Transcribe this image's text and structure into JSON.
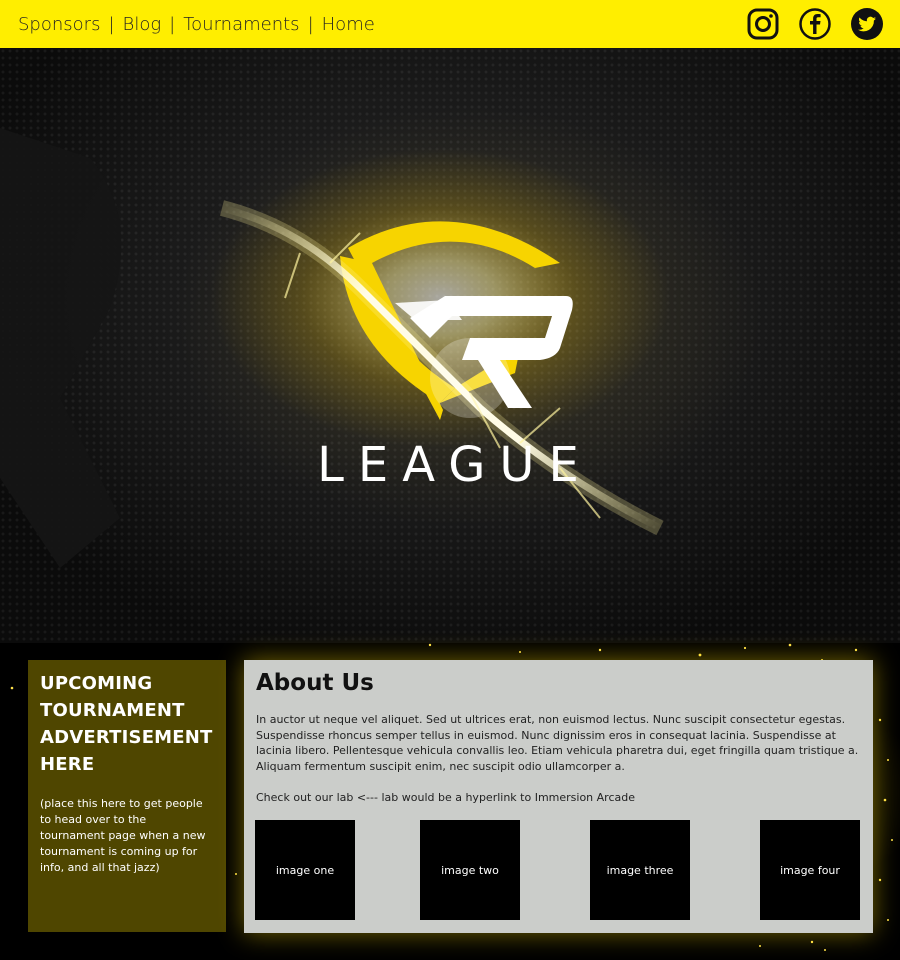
{
  "nav": {
    "items": [
      "Sponsors",
      "Blog",
      "Tournaments",
      "Home"
    ],
    "separator": "|"
  },
  "social": {
    "icons": [
      "instagram-icon",
      "facebook-icon",
      "twitter-icon"
    ]
  },
  "hero": {
    "wordmark": "LEAGUE"
  },
  "promo": {
    "title": "UPCOMING TOURNAMENT ADVERTISEMENT HERE",
    "note": "(place this here to get people to head over to the tournament page when a new tournament is coming up for info, and all that jazz)"
  },
  "about": {
    "title": "About Us",
    "body": "In auctor ut neque vel aliquet. Sed ut ultrices erat, non euismod lectus. Nunc suscipit consectetur egestas. Suspendisse rhoncus semper tellus in euismod. Nunc dignissim eros in consequat lacinia. Suspendisse at lacinia libero. Pellentesque vehicula convallis leo. Etiam vehicula pharetra dui, eget fringilla quam tristique a. Aliquam fermentum suscipit enim, nec suscipit odio ullamcorper a.",
    "lab_line": "Check out our lab <--- lab would be a hyperlink to Immersion Arcade",
    "images": [
      "image one",
      "image two",
      "image three",
      "image four"
    ]
  },
  "colors": {
    "accent": "#ffee00",
    "promo_bg": "#4f4600",
    "about_bg": "#cbcdca"
  }
}
